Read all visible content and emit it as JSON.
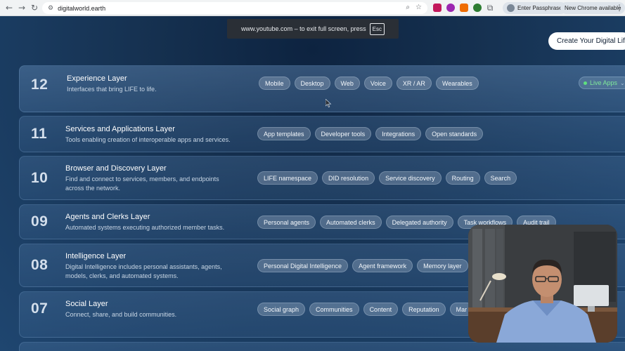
{
  "browser": {
    "url": "digitalworld.earth",
    "passphrase_chip": "Enter Passphrase",
    "update_chip": "New Chrome available"
  },
  "fullscreen_banner": {
    "text": "www.youtube.com – to exit full screen, press",
    "key": "Esc"
  },
  "cta": {
    "label": "Create Your Digital Life"
  },
  "layers": [
    {
      "number": "12",
      "title": "Experience Layer",
      "description": "Interfaces that bring LIFE to life.",
      "tags": [
        "Mobile",
        "Desktop",
        "Web",
        "Voice",
        "XR / AR",
        "Wearables"
      ],
      "live_label": "Live Apps"
    },
    {
      "number": "11",
      "title": "Services and Applications Layer",
      "description": "Tools enabling creation of interoperable apps and services.",
      "tags": [
        "App templates",
        "Developer tools",
        "Integrations",
        "Open standards"
      ]
    },
    {
      "number": "10",
      "title": "Browser and Discovery Layer",
      "description": "Find and connect to services, members, and endpoints across the network.",
      "tags": [
        "LIFE namespace",
        "DID resolution",
        "Service discovery",
        "Routing",
        "Search"
      ]
    },
    {
      "number": "09",
      "title": "Agents and Clerks Layer",
      "description": "Automated systems executing authorized member tasks.",
      "tags": [
        "Personal agents",
        "Automated clerks",
        "Delegated authority",
        "Task workflows",
        "Audit trail"
      ]
    },
    {
      "number": "08",
      "title": "Intelligence Layer",
      "description": "Digital Intelligence includes personal assistants, agents, models, clerks, and automated systems.",
      "tags": [
        "Personal Digital Intelligence",
        "Agent framework",
        "Memory layer"
      ]
    },
    {
      "number": "07",
      "title": "Social Layer",
      "description": "Connect, share, and build communities.",
      "tags": [
        "Social graph",
        "Communities",
        "Content",
        "Reputation",
        "Mar"
      ]
    }
  ],
  "colors": {
    "accent_live": "#7ee89a",
    "page_bg": "#1b3a5e"
  }
}
